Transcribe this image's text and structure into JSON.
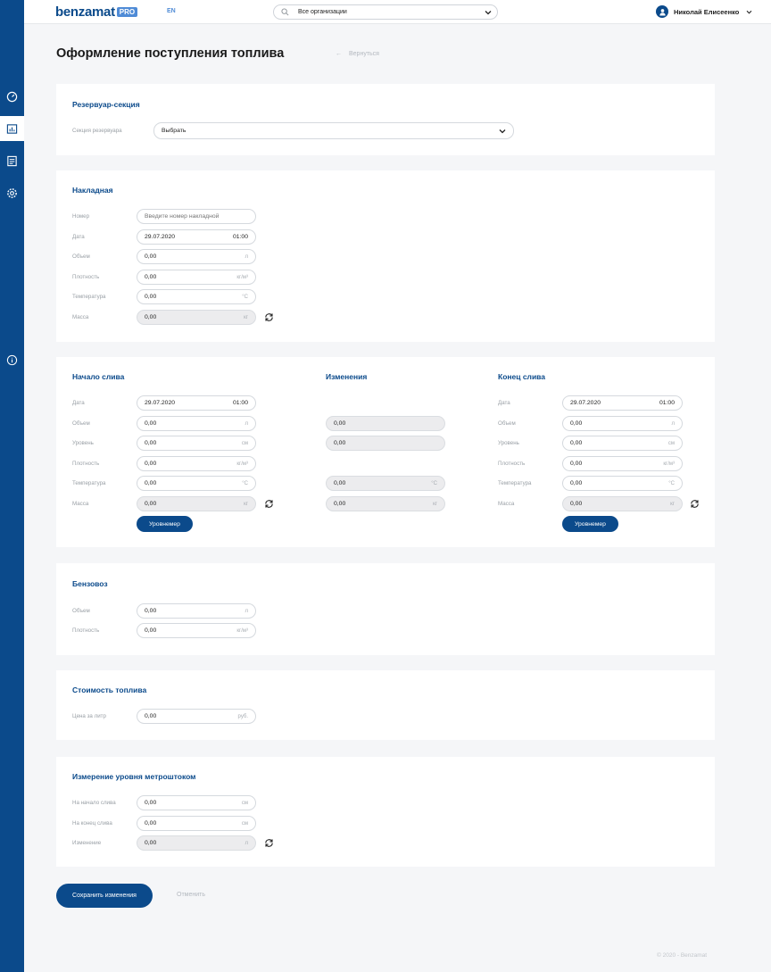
{
  "header": {
    "logo": "benzamat",
    "logo_badge": "PRO",
    "lang": "EN",
    "org_select": "Все организации",
    "user_name": "Николай Елисеенко"
  },
  "sidebar": {
    "items": [
      {
        "icon": "dashboard-icon"
      },
      {
        "icon": "reports-icon",
        "active": true
      },
      {
        "icon": "documents-icon"
      },
      {
        "icon": "settings-icon"
      },
      {
        "icon": "info-icon"
      }
    ]
  },
  "page": {
    "title": "Оформление поступления топлива",
    "back": "Вернуться"
  },
  "reservoir": {
    "title": "Резервуар-секция",
    "label": "Секция резервуара",
    "value": "Выбрать"
  },
  "invoice": {
    "title": "Накладная",
    "number_label": "Номер",
    "number_placeholder": "Введите номер накладной",
    "date_label": "Дата",
    "date": "29.07.2020",
    "time": "01:00",
    "volume_label": "Объем",
    "volume": "0,00",
    "volume_unit": "л",
    "density_label": "Плотность",
    "density": "0,00",
    "density_unit": "кг/м³",
    "temp_label": "Температура",
    "temp": "0,00",
    "temp_unit": "°С",
    "mass_label": "Масса",
    "mass": "0,00",
    "mass_unit": "кг"
  },
  "drain_start": {
    "title": "Начало слива",
    "date_label": "Дата",
    "date": "29.07.2020",
    "time": "01:00",
    "volume_label": "Объем",
    "volume": "0,00",
    "volume_unit": "л",
    "level_label": "Уровень",
    "level": "0,00",
    "level_unit": "см",
    "density_label": "Плотность",
    "density": "0,00",
    "density_unit": "кг/м³",
    "temp_label": "Температура",
    "temp": "0,00",
    "temp_unit": "°С",
    "mass_label": "Масса",
    "mass": "0,00",
    "mass_unit": "кг",
    "gauge_button": "Уровнемер"
  },
  "changes": {
    "title": "Изменения",
    "volume": "0,00",
    "level": "0,00",
    "temp": "0,00",
    "temp_unit": "°С",
    "mass": "0,00",
    "mass_unit": "кг"
  },
  "drain_end": {
    "title": "Конец слива",
    "date_label": "Дата",
    "date": "29.07.2020",
    "time": "01:00",
    "volume_label": "Объем",
    "volume": "0,00",
    "volume_unit": "л",
    "level_label": "Уровень",
    "level": "0,00",
    "level_unit": "см",
    "density_label": "Плотность",
    "density": "0,00",
    "density_unit": "кг/м³",
    "temp_label": "Температура",
    "temp": "0,00",
    "temp_unit": "°С",
    "mass_label": "Масса",
    "mass": "0,00",
    "mass_unit": "кг",
    "gauge_button": "Уровнемер"
  },
  "tanker": {
    "title": "Бензовоз",
    "volume_label": "Объем",
    "volume": "0,00",
    "volume_unit": "л",
    "density_label": "Плотность",
    "density": "0,00",
    "density_unit": "кг/м³"
  },
  "cost": {
    "title": "Стоимость топлива",
    "price_label": "Цена за литр",
    "price": "0,00",
    "price_unit": "руб."
  },
  "dipstick": {
    "title": "Измерение уровня метроштоком",
    "start_label": "На начало слива",
    "start": "0,00",
    "start_unit": "см",
    "end_label": "На конец слива",
    "end": "0,00",
    "end_unit": "см",
    "change_label": "Изменение",
    "change": "0,00",
    "change_unit": "л"
  },
  "actions": {
    "save": "Сохранить изменения",
    "cancel": "Отменить"
  },
  "footer": {
    "copyright": "© 2020 - Benzamat"
  },
  "colors": {
    "brand": "#0b4a8b",
    "accent": "#4f8bd6",
    "background": "#f5f6f8"
  }
}
